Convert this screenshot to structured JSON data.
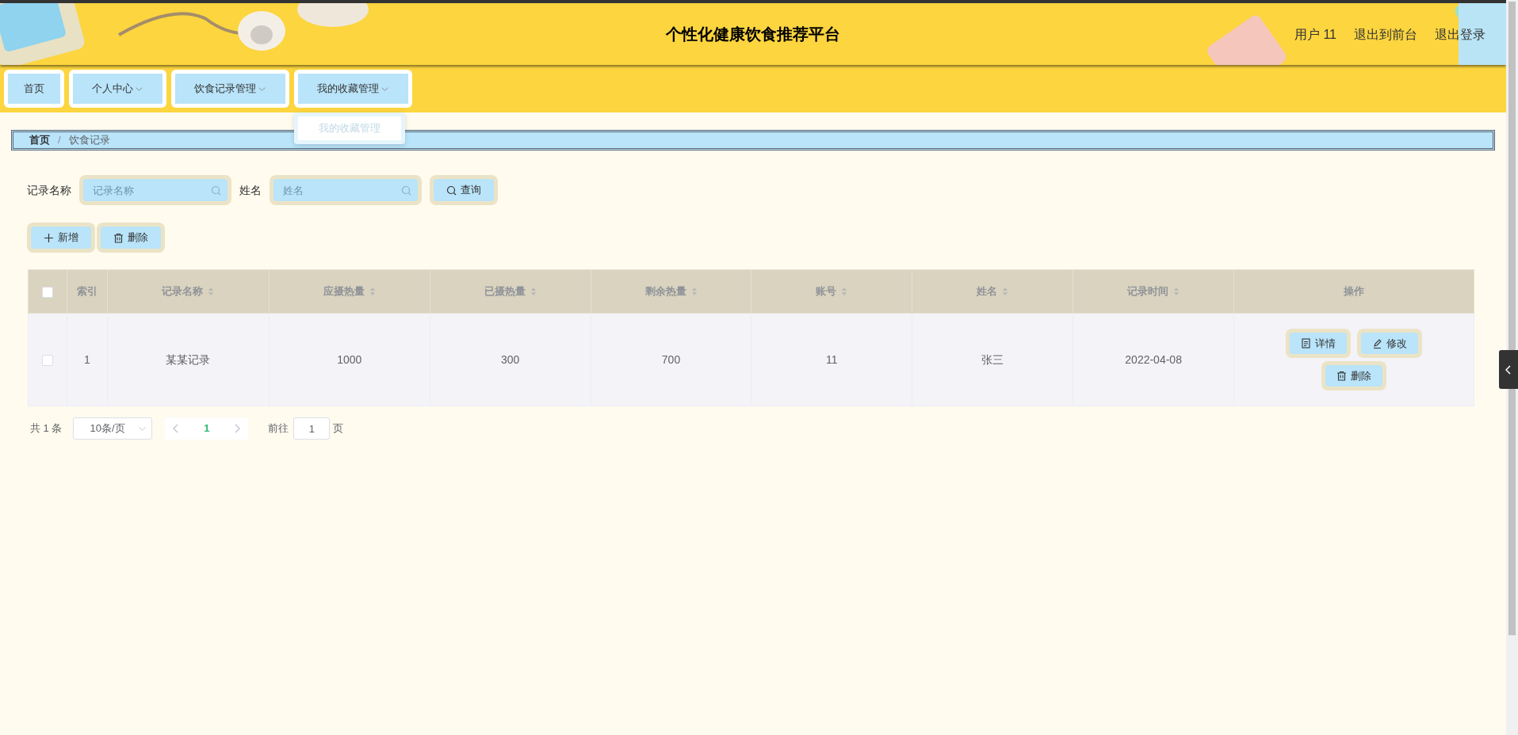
{
  "header": {
    "title": "个性化健康饮食推荐平台",
    "links": [
      "用户 11",
      "退出到前台",
      "退出登录"
    ]
  },
  "nav": {
    "items": [
      {
        "label": "首页",
        "dropdown": false
      },
      {
        "label": "个人中心",
        "dropdown": true
      },
      {
        "label": "饮食记录管理",
        "dropdown": true
      },
      {
        "label": "我的收藏管理",
        "dropdown": true,
        "menu": [
          "我的收藏管理"
        ]
      }
    ]
  },
  "breadcrumb": {
    "items": [
      "首页",
      "饮食记录"
    ],
    "separator": "/"
  },
  "search": {
    "fields": [
      {
        "label": "记录名称",
        "placeholder": "记录名称"
      },
      {
        "label": "姓名",
        "placeholder": "姓名"
      }
    ],
    "button": "查询"
  },
  "actions": [
    {
      "kind": "add",
      "label": "新增"
    },
    {
      "kind": "delete",
      "label": "删除"
    }
  ],
  "table": {
    "columns": [
      {
        "label": "索引",
        "sortable": false
      },
      {
        "label": "记录名称",
        "sortable": true
      },
      {
        "label": "应摄热量",
        "sortable": true
      },
      {
        "label": "已摄热量",
        "sortable": true
      },
      {
        "label": "剩余热量",
        "sortable": true
      },
      {
        "label": "账号",
        "sortable": true
      },
      {
        "label": "姓名",
        "sortable": true
      },
      {
        "label": "记录时间",
        "sortable": true
      },
      {
        "label": "操作",
        "sortable": false
      }
    ],
    "select_all": {
      "checked": false
    },
    "rows": [
      {
        "checked": false,
        "cells": [
          "1",
          "某某记录",
          "1000",
          "300",
          "700",
          "11",
          "张三",
          "2022-04-08"
        ],
        "buttons": [
          {
            "kind": "detail",
            "label": "详情"
          },
          {
            "kind": "edit",
            "label": "修改"
          },
          {
            "kind": "delete",
            "label": "删除"
          }
        ]
      }
    ]
  },
  "pagination": {
    "total": "共 1 条",
    "page_size": "10条/页",
    "pages": [
      {
        "label": "1",
        "selected": true
      }
    ],
    "goto_label": "前往",
    "goto_value": "1",
    "goto_suffix": "页"
  }
}
